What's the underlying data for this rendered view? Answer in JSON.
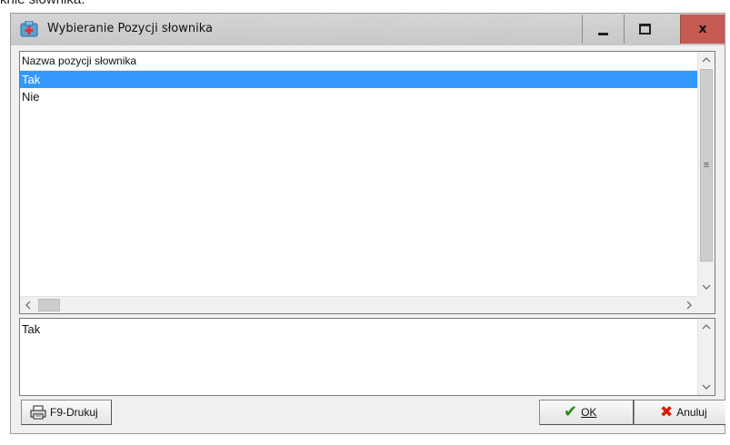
{
  "cropped_caption": "knie słownika.",
  "window": {
    "title": "Wybieranie Pozycji słownika",
    "controls": {
      "minimize": "–",
      "maximize": "□",
      "close": "x"
    }
  },
  "list": {
    "header": "Nazwa pozycji słownika",
    "rows": [
      {
        "label": "Tak",
        "selected": true
      },
      {
        "label": "Nie",
        "selected": false
      }
    ],
    "scroll": {
      "up": "^",
      "down": "v",
      "left": "<",
      "right": ">",
      "thumb_grip": "≡"
    }
  },
  "detail": {
    "text": "Tak",
    "scroll": {
      "up": "^",
      "down": "v"
    }
  },
  "buttons": {
    "print_label": "F9-Drukuj",
    "ok_label": "OK",
    "cancel_label": "Anuluj"
  },
  "colors": {
    "selection": "#3399ff",
    "close_button": "#c85a54",
    "ok_icon": "#2c8a10",
    "cancel_icon": "#d41f10"
  }
}
